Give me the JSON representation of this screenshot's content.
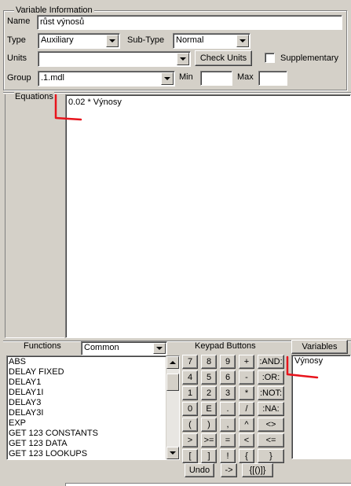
{
  "variable_info": {
    "legend": "Variable Information",
    "name_label": "Name",
    "name_value": "růst výnosů",
    "type_label": "Type",
    "type_value": "Auxiliary",
    "subtype_label": "Sub-Type",
    "subtype_value": "Normal",
    "units_label": "Units",
    "units_value": "",
    "check_units_label": "Check Units",
    "supplementary_label": "Supplementary",
    "supplementary_checked": false,
    "group_label": "Group",
    "group_value": ".1.mdl",
    "min_label": "Min",
    "min_value": "",
    "max_label": "Max",
    "max_value": ""
  },
  "equations": {
    "label": "Equations",
    "text": "0.02 * Výnosy"
  },
  "functions": {
    "label": "Functions",
    "filter_value": "Common",
    "items": [
      "ABS",
      "DELAY FIXED",
      "DELAY1",
      "DELAY1I",
      "DELAY3",
      "DELAY3I",
      "EXP",
      "GET 123 CONSTANTS",
      "GET 123 DATA",
      "GET 123 LOOKUPS"
    ]
  },
  "keypad": {
    "label": "Keypad Buttons",
    "rows": [
      [
        "7",
        "8",
        "9",
        "+",
        ":AND:"
      ],
      [
        "4",
        "5",
        "6",
        "-",
        ":OR:"
      ],
      [
        "1",
        "2",
        "3",
        "*",
        ":NOT:"
      ],
      [
        "0",
        "E",
        ".",
        "/",
        ":NA:"
      ],
      [
        "(",
        ")",
        ",",
        "^",
        "<>"
      ],
      [
        ">",
        ">=",
        "=",
        "<",
        "<="
      ],
      [
        "[",
        "]",
        "!",
        "{",
        "}"
      ]
    ],
    "undo_label": "Undo",
    "arrow_label": "->",
    "braces_label": "{[()]}"
  },
  "variables": {
    "button_label": "Variables",
    "items": [
      "Výnosy"
    ]
  },
  "colors": {
    "annotation": "#e8141c",
    "window_bg": "#d4d0c8"
  }
}
